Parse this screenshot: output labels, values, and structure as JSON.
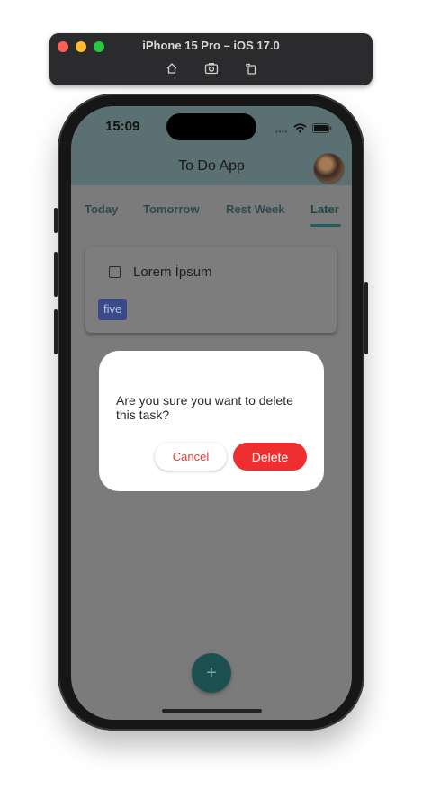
{
  "simulator": {
    "title": "iPhone 15 Pro – iOS 17.0",
    "tools": [
      "home-icon",
      "screenshot-icon",
      "rotate-icon"
    ]
  },
  "status_bar": {
    "time": "15:09"
  },
  "app": {
    "title": "To Do App",
    "tabs": [
      {
        "label": "Today"
      },
      {
        "label": "Tomorrow"
      },
      {
        "label": "Rest Week"
      },
      {
        "label": "Later"
      }
    ],
    "active_tab": "Later",
    "task": {
      "title": "Lorem İpsum",
      "checked": false,
      "tag": "five"
    }
  },
  "dialog": {
    "message": "Are you sure you want to delete this task?",
    "cancel_label": "Cancel",
    "delete_label": "Delete"
  },
  "fab": {
    "label": "+"
  },
  "colors": {
    "header": "#5b7072",
    "accent": "#1c4f50",
    "danger": "#ef2f2f",
    "tag": "#3a4a86"
  }
}
